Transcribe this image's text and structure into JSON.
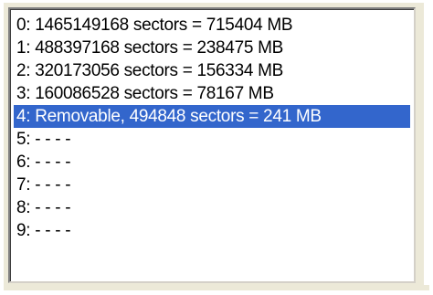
{
  "drive_list": {
    "selected_index": 4,
    "colors": {
      "selection_background": "#3366cc",
      "selection_text": "#ffffff",
      "frame_background": "#ece9d8"
    },
    "items": [
      {
        "label": "0: 1465149168 sectors = 715404 MB"
      },
      {
        "label": "1: 488397168 sectors = 238475 MB"
      },
      {
        "label": "2: 320173056 sectors = 156334 MB"
      },
      {
        "label": "3: 160086528 sectors = 78167 MB"
      },
      {
        "label": "4: Removable, 494848 sectors = 241 MB"
      },
      {
        "label": "5: - - - -"
      },
      {
        "label": "6: - - - -"
      },
      {
        "label": "7: - - - -"
      },
      {
        "label": "8: - - - -"
      },
      {
        "label": "9: - - - -"
      }
    ]
  }
}
